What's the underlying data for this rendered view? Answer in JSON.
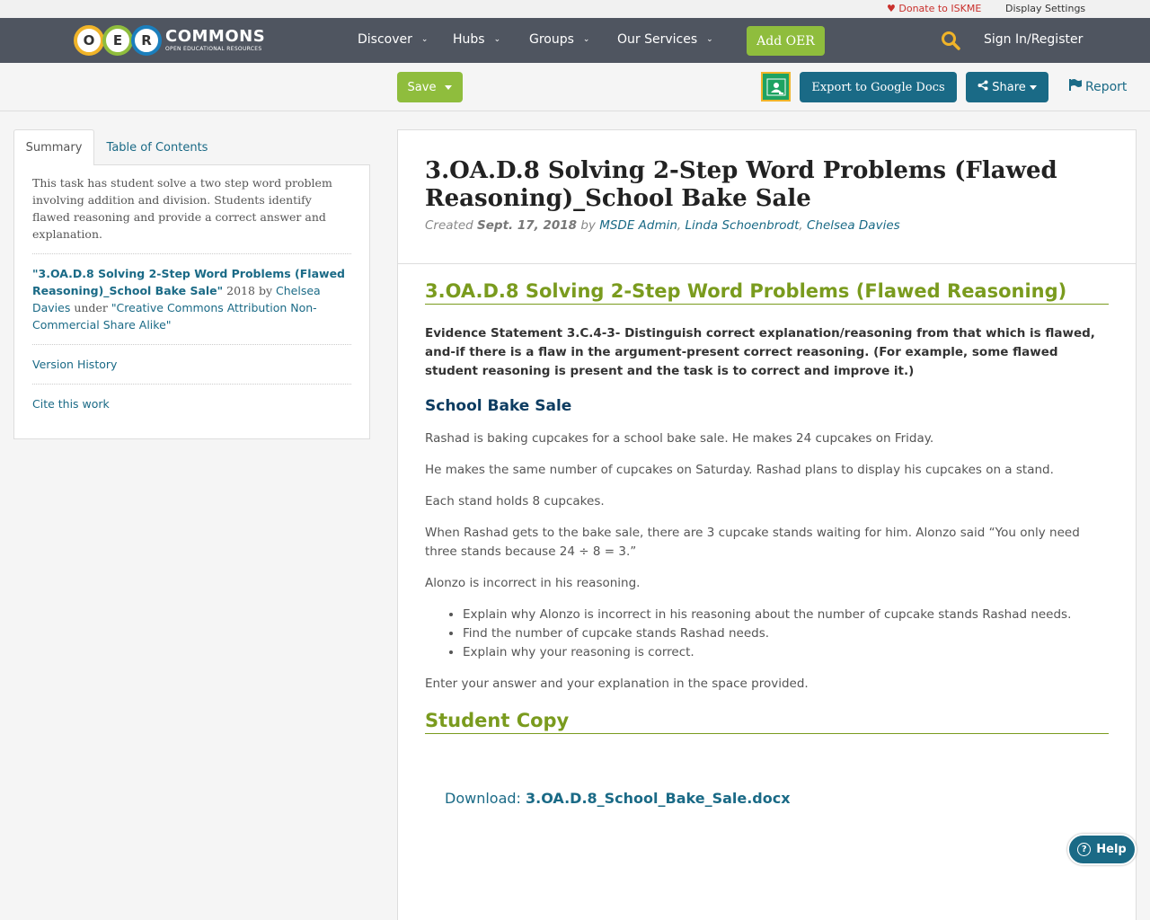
{
  "utility": {
    "donate": "Donate to ISKME",
    "display_settings": "Display Settings"
  },
  "logo": {
    "letters": [
      "O",
      "E",
      "R"
    ],
    "name": "COMMONS",
    "tagline": "OPEN EDUCATIONAL RESOURCES"
  },
  "nav": {
    "items": [
      {
        "label": "Discover"
      },
      {
        "label": "Hubs"
      },
      {
        "label": "Groups"
      },
      {
        "label": "Our Services"
      }
    ],
    "add_oer": "Add OER",
    "sign_in": "Sign In/Register"
  },
  "toolbar": {
    "save": "Save",
    "export": "Export to Google Docs",
    "share": "Share",
    "report": "Report"
  },
  "sidebar": {
    "tabs": [
      "Summary",
      "Table of Contents"
    ],
    "summary": "This task has student solve a two step word problem involving addition and division. Students identify flawed reasoning and provide a correct answer and explanation.",
    "attribution": {
      "title": "\"3.OA.D.8 Solving 2-Step Word Problems (Flawed Reasoning)_School Bake Sale\"",
      "year": "2018 by",
      "author": "Chelsea Davies",
      "under": "under",
      "license": "\"Creative Commons Attribution Non-Commercial Share Alike\""
    },
    "version_history": "Version History",
    "cite": "Cite this work"
  },
  "resource": {
    "title": "3.OA.D.8 Solving 2-Step Word Problems (Flawed Reasoning)_School Bake Sale",
    "created_label": "Created",
    "created_date": "Sept. 17, 2018",
    "by": "by",
    "authors": [
      "MSDE Admin",
      "Linda Schoenbrodt",
      "Chelsea Davies"
    ]
  },
  "content": {
    "section1": "3.OA.D.8  Solving 2-Step Word Problems (Flawed Reasoning)",
    "evidence": " Evidence Statement 3.C.4-3- Distinguish correct explanation/reasoning from that which is flawed, and-if there is a flaw in the argument-present correct reasoning. (For example, some flawed student reasoning is present and the task is to correct and improve it.)",
    "subheading": "School Bake Sale",
    "paragraphs": [
      "Rashad is baking cupcakes for a school bake sale. He makes 24 cupcakes on Friday.",
      "He makes the same number of cupcakes on Saturday. Rashad plans to display his cupcakes on a stand.",
      "Each stand holds 8 cupcakes.",
      " When Rashad gets to the bake sale, there are 3 cupcake stands waiting for him. Alonzo said “You only need three stands because 24 ÷ 8 = 3.”",
      "Alonzo is incorrect in his reasoning."
    ],
    "bullets": [
      "Explain why Alonzo is incorrect in his reasoning about the number of cupcake stands Rashad needs.",
      "Find the number of cupcake stands Rashad needs.",
      "Explain why your reasoning is correct."
    ],
    "closing": "Enter your answer and your explanation in the space provided.",
    "section2": "Student Copy",
    "download_label": "Download:",
    "download_file": "3.OA.D.8_School_Bake_Sale.docx"
  },
  "help": "Help",
  "colors": {
    "nav_bg": "#4f5560",
    "green": "#8fbd3d",
    "teal": "#1a6a86",
    "section_green": "#7a9b1e",
    "navy": "#0d3c61"
  }
}
